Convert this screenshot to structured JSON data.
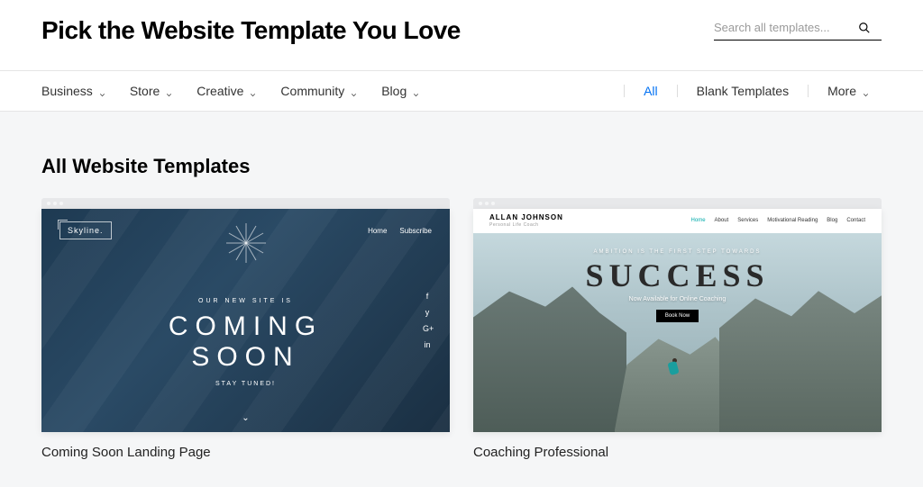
{
  "header": {
    "title": "Pick the Website Template You Love",
    "search_placeholder": "Search all templates..."
  },
  "nav": {
    "categories": [
      {
        "label": "Business"
      },
      {
        "label": "Store"
      },
      {
        "label": "Creative"
      },
      {
        "label": "Community"
      },
      {
        "label": "Blog"
      }
    ],
    "filters": {
      "all": "All",
      "blank": "Blank Templates",
      "more": "More"
    }
  },
  "section": {
    "title": "All Website Templates"
  },
  "templates": [
    {
      "title": "Coming Soon Landing Page",
      "preview": {
        "logo": "Skyline.",
        "nav": [
          "Home",
          "Subscribe"
        ],
        "tagline": "OUR NEW SITE IS",
        "main_line1": "COMING",
        "main_line2": "SOON",
        "sub": "STAY TUNED!",
        "social": [
          "f",
          "y",
          "G+",
          "in"
        ]
      }
    },
    {
      "title": "Coaching Professional",
      "preview": {
        "brand": "ALLAN JOHNSON",
        "brand_sub": "Personal Life Coach",
        "nav": [
          "Home",
          "About",
          "Services",
          "Motivational Reading",
          "Blog",
          "Contact"
        ],
        "tagline": "AMBITION IS THE FIRST STEP TOWARDS",
        "main": "SUCCESS",
        "sub": "Now Available for Online Coaching",
        "cta": "Book Now"
      }
    }
  ]
}
